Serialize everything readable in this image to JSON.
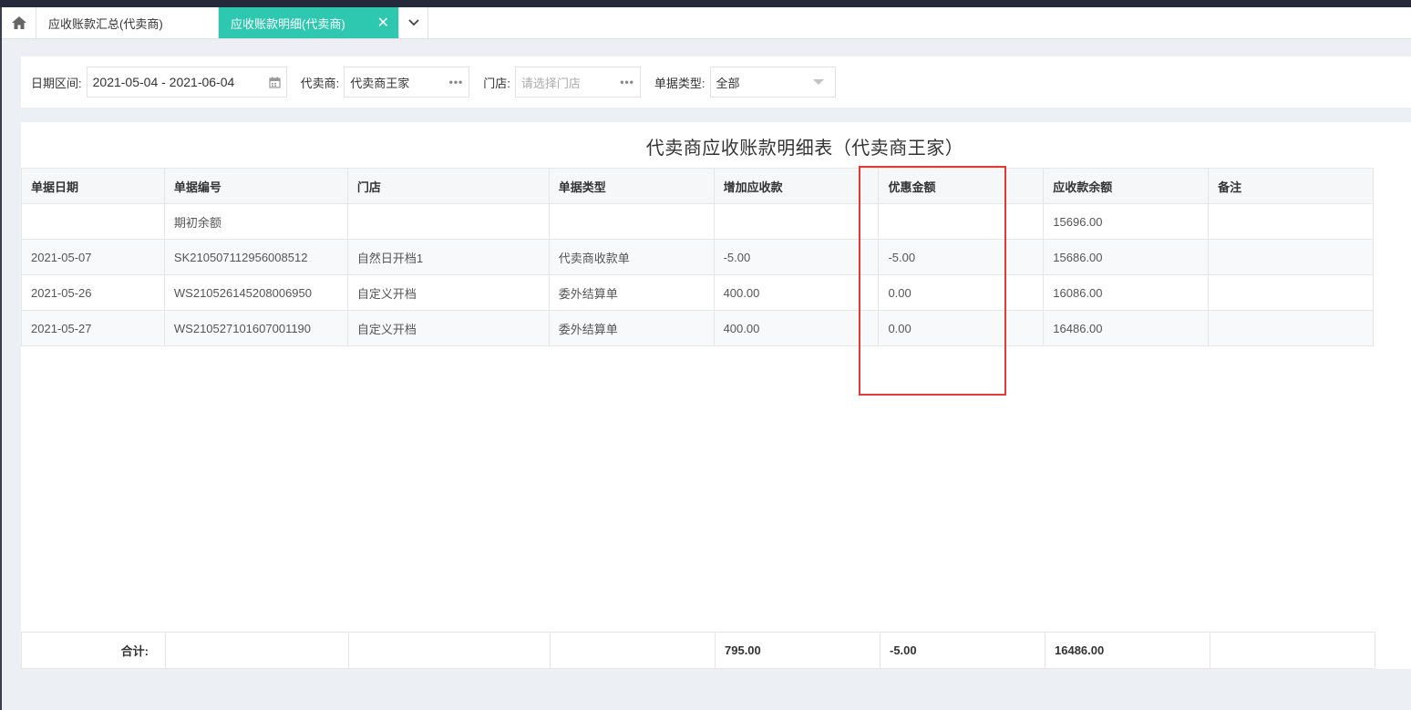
{
  "tabs": [
    {
      "label": "应收账款汇总(代卖商)",
      "active": false
    },
    {
      "label": "应收账款明细(代卖商)",
      "active": true
    }
  ],
  "filters": {
    "date_label": "日期区间:",
    "date_value": "2021-05-04 - 2021-06-04",
    "agent_label": "代卖商:",
    "agent_value": "代卖商王家",
    "store_label": "门店:",
    "store_placeholder": "请选择门店",
    "type_label": "单据类型:",
    "type_value": "全部"
  },
  "report": {
    "title": "代卖商应收账款明细表（代卖商王家）",
    "columns": [
      "单据日期",
      "单据编号",
      "门店",
      "单据类型",
      "增加应收款",
      "优惠金额",
      "应收款余额",
      "备注"
    ],
    "rows": [
      [
        "",
        "期初余额",
        "",
        "",
        "",
        "",
        "15696.00",
        ""
      ],
      [
        "2021-05-07",
        "SK210507112956008512",
        "自然日开档1",
        "代卖商收款单",
        "-5.00",
        "-5.00",
        "15686.00",
        ""
      ],
      [
        "2021-05-26",
        "WS210526145208006950",
        "自定义开档",
        "委外结算单",
        "400.00",
        "0.00",
        "16086.00",
        ""
      ],
      [
        "2021-05-27",
        "WS210527101607001190",
        "自定义开档",
        "委外结算单",
        "400.00",
        "0.00",
        "16486.00",
        ""
      ]
    ],
    "totals": {
      "label": "合计:",
      "increase": "795.00",
      "discount": "-5.00",
      "balance": "16486.00"
    }
  },
  "colors": {
    "accent": "#2ec7b0",
    "highlight_box": "#e53935"
  },
  "icons": [
    "home-icon",
    "close-icon",
    "chevron-down-icon",
    "calendar-icon",
    "more-dots-icon",
    "dropdown-caret-icon"
  ]
}
